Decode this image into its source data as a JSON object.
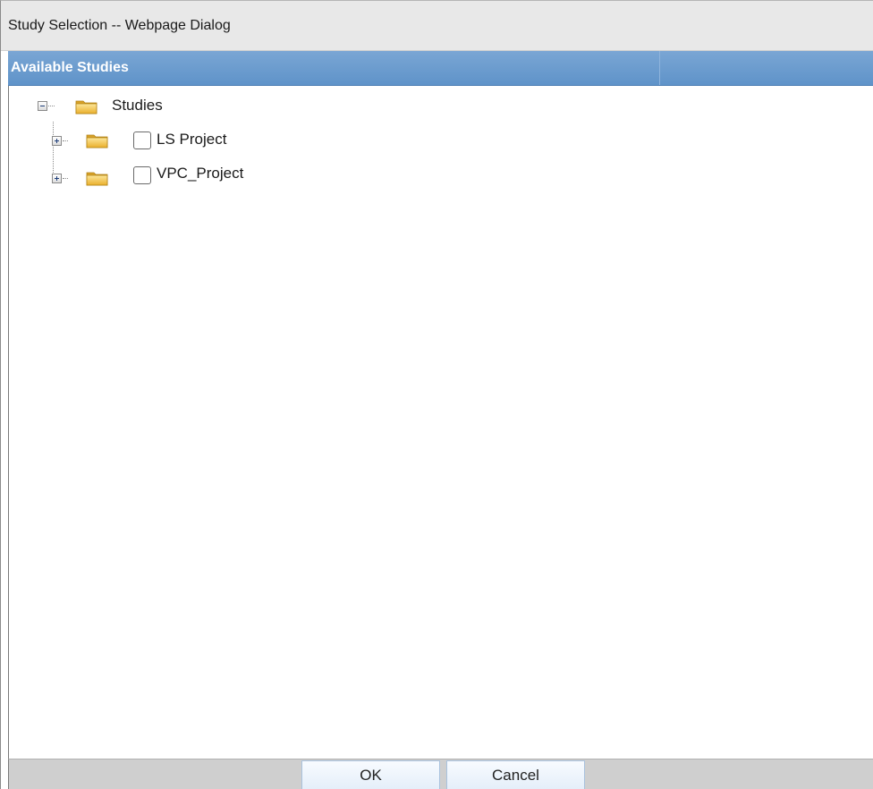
{
  "window": {
    "title": "Study Selection -- Webpage Dialog"
  },
  "panel": {
    "header": "Available Studies"
  },
  "tree": {
    "root": {
      "label": "Studies",
      "expanded": true,
      "icon": "folder-icon"
    },
    "children": [
      {
        "label": "LS Project",
        "checked": false,
        "expanded": false,
        "icon": "folder-icon"
      },
      {
        "label": "VPC_Project",
        "checked": false,
        "expanded": false,
        "icon": "folder-icon"
      }
    ]
  },
  "buttons": {
    "ok": "OK",
    "cancel": "Cancel"
  },
  "colors": {
    "header_blue": "#6699cc",
    "folder_yellow": "#f5c542",
    "footer_gray": "#cfcfcf"
  }
}
